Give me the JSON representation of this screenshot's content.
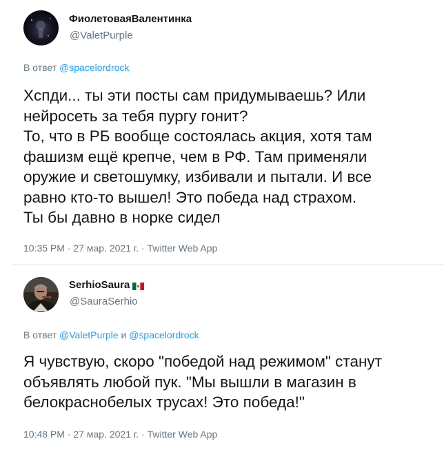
{
  "tweets": [
    {
      "author": {
        "display_name": "ФиолетоваяВалентинка",
        "handle": "@ValetPurple",
        "avatar_icon": "dark-space-avatar"
      },
      "reply_prefix": "В ответ",
      "reply_to": "@spacelordrock",
      "text_lines": [
        "Хспди... ты эти посты сам придумываешь? Или",
        "нейросеть за тебя пургу гонит?",
        "То, что в РБ вообще состоялась акция, хотя там",
        "фашизм ещё крепче, чем в РФ. Там применяли",
        "оружие и светошумку, избивали и пытали. И все",
        "равно кто-то вышел! Это победа над страхом.",
        "Ты бы давно в норке сидел"
      ],
      "time": "10:35 PM",
      "date": "27 мар. 2021 г.",
      "source": "Twitter Web App",
      "separator": "·"
    },
    {
      "author": {
        "display_name": "SerhioSaura",
        "handle": "@SauraSerhio",
        "avatar_icon": "man-with-cigar-avatar",
        "name_emoji": "mexico-flag-icon"
      },
      "reply_prefix": "В ответ",
      "reply_to_1": "@ValetPurple",
      "reply_conjunction": "и",
      "reply_to_2": "@spacelordrock",
      "text_lines": [
        "Я чувствую, скоро \"победой над режимом\" станут",
        "объявлять любой пук. \"Мы вышли в магазин в",
        "белокраснобелых трусах! Это победа!\""
      ],
      "time": "10:48 PM",
      "date": "27 мар. 2021 г.",
      "source": "Twitter Web App",
      "separator": "·"
    }
  ],
  "colors": {
    "text": "#14171a",
    "secondary": "#657786",
    "link": "#1da1f2",
    "divider": "#e6ecf0"
  }
}
